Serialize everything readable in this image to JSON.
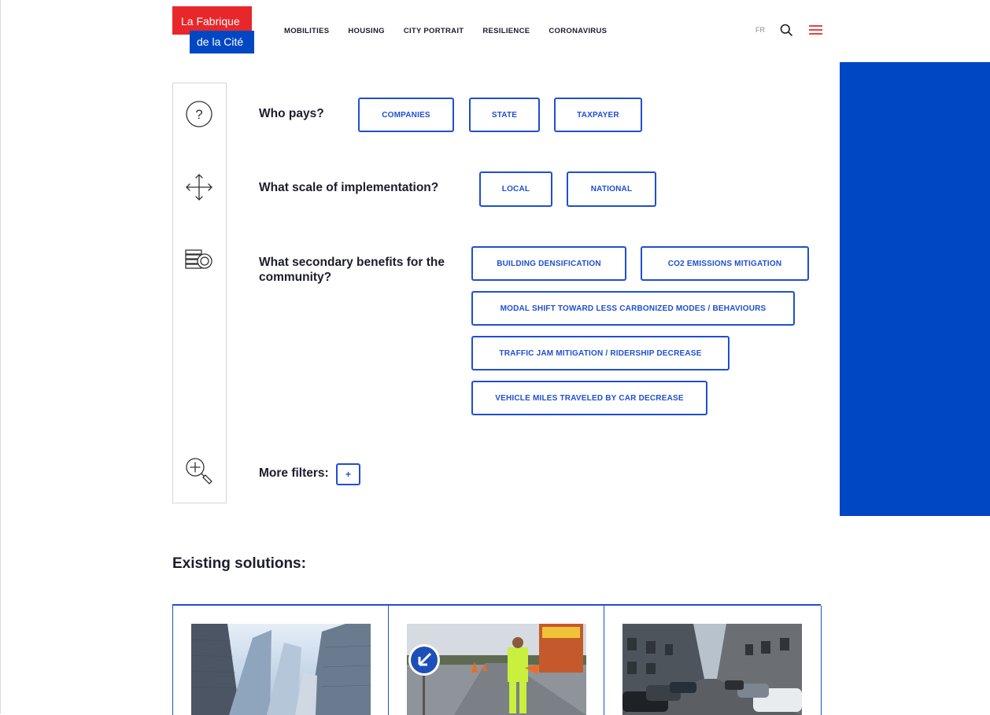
{
  "header": {
    "logo_line1": "La Fabrique",
    "logo_line2": "de la Cité",
    "nav": [
      "MOBILITIES",
      "HOUSING",
      "CITY PORTRAIT",
      "RESILIENCE",
      "CORONAVIRUS"
    ],
    "lang": "FR",
    "search_icon": "search-icon",
    "menu_icon": "hamburger-menu-icon"
  },
  "filters": {
    "who_pays": {
      "question": "Who pays?",
      "options": [
        "COMPANIES",
        "STATE",
        "TAXPAYER"
      ],
      "icon": "question-icon"
    },
    "scale": {
      "question": "What scale of implementation?",
      "options": [
        "LOCAL",
        "NATIONAL"
      ],
      "icon": "arrows-move-icon"
    },
    "benefits": {
      "question": "What secondary benefits for the community?",
      "options": [
        "BUILDING DENSIFICATION",
        "CO2 EMISSIONS MITIGATION",
        "MODAL SHIFT TOWARD LESS CARBONIZED MODES / BEHAVIOURS",
        "TRAFFIC JAM MITIGATION / RIDERSHIP DECREASE",
        "VEHICLE MILES TRAVELED BY CAR DECREASE"
      ],
      "icon": "coins-icon"
    },
    "more": {
      "label": "More filters:",
      "button": "+",
      "icon": "zoom-in-icon"
    }
  },
  "solutions": {
    "title": "Existing solutions:",
    "cards": [
      {
        "image": "skyscrapers-photo"
      },
      {
        "image": "road-worker-photo"
      },
      {
        "image": "parked-cars-street-photo"
      }
    ]
  },
  "colors": {
    "accent_blue": "#0047c4",
    "chip_blue": "#1f4fd1",
    "brand_red": "#e8272a"
  }
}
